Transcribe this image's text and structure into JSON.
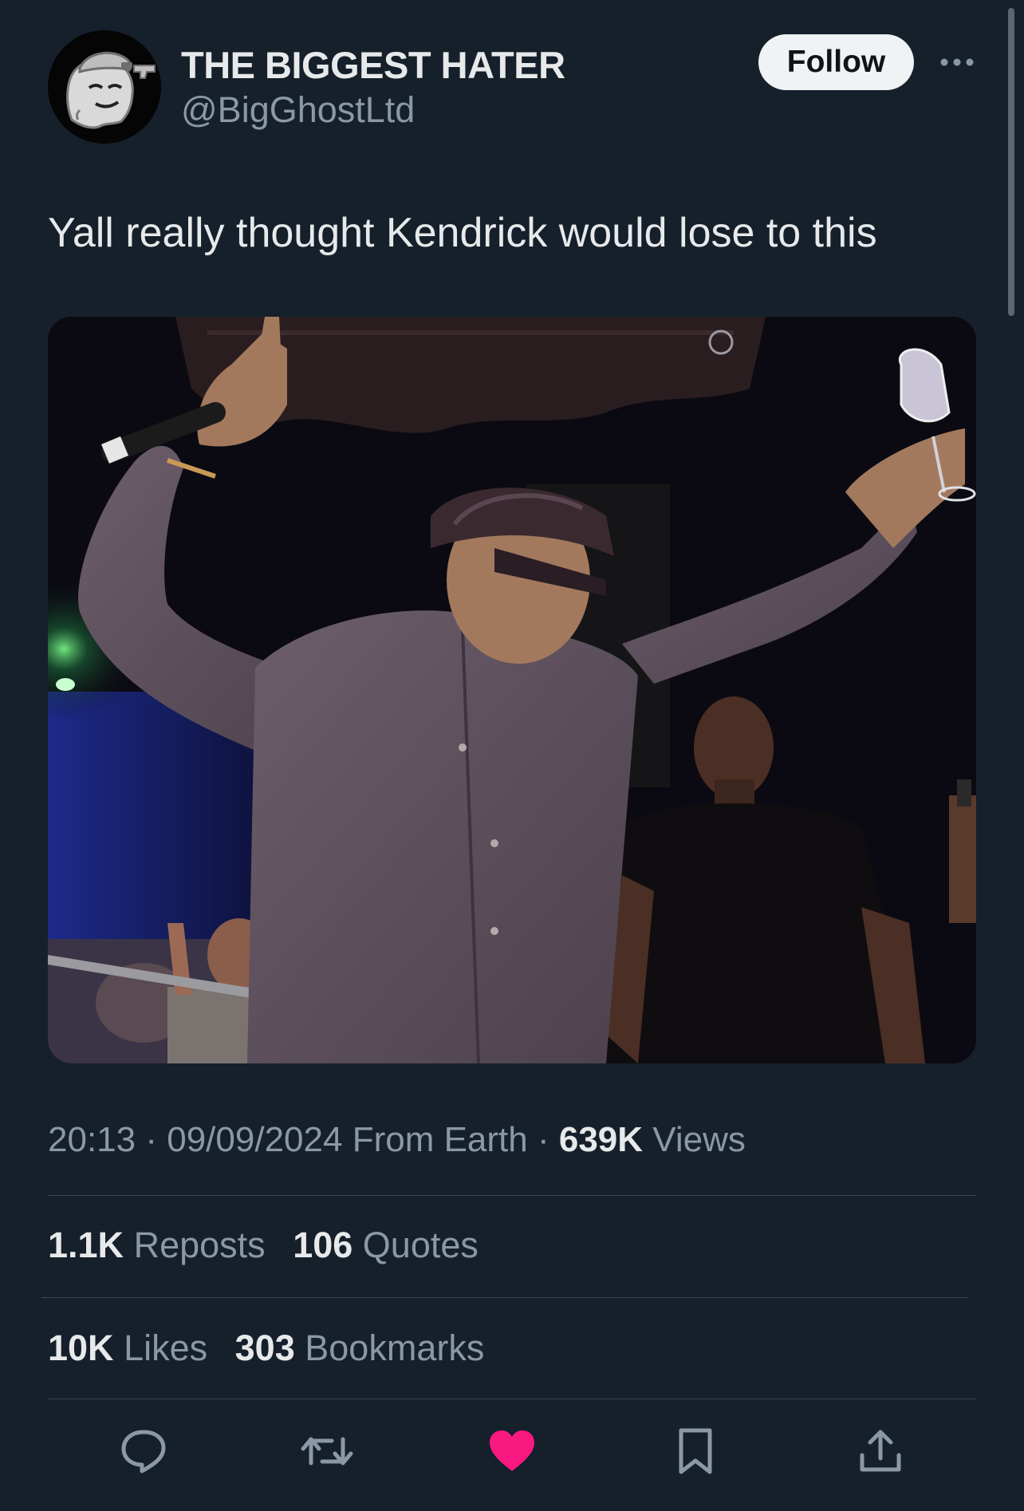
{
  "author": {
    "display_name": "THE BIGGEST HATER",
    "handle": "@BigGhostLtd"
  },
  "header": {
    "follow_label": "Follow",
    "more_icon": "more-horizontal-icon"
  },
  "tweet": {
    "text": "Yall really thought Kendrick would lose to this",
    "media_description": "photo"
  },
  "meta": {
    "time": "20:13",
    "separator": "·",
    "date": "09/09/2024",
    "source": "From Earth",
    "views_count": "639K",
    "views_label": "Views"
  },
  "stats": {
    "reposts_count": "1.1K",
    "reposts_label": "Reposts",
    "quotes_count": "106",
    "quotes_label": "Quotes",
    "likes_count": "10K",
    "likes_label": "Likes",
    "bookmarks_count": "303",
    "bookmarks_label": "Bookmarks"
  },
  "actions": {
    "reply_icon": "reply-icon",
    "repost_icon": "repost-icon",
    "like_icon": "heart-icon",
    "bookmark_icon": "bookmark-icon",
    "share_icon": "share-icon"
  },
  "colors": {
    "background": "#15202b",
    "primary_text": "#e7e9ea",
    "secondary_text": "#8b98a5",
    "divider": "#38444d",
    "like_active": "#f91880",
    "icon": "#8b98a5"
  }
}
